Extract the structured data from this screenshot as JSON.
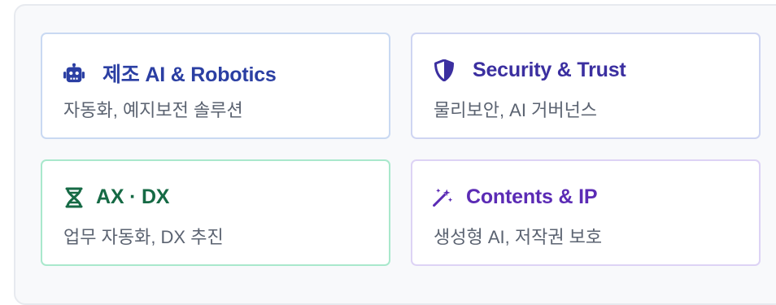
{
  "cards": [
    {
      "title": "제조 AI & Robotics",
      "description": "자동화, 예지보전 솔루션",
      "icon": "robot-icon",
      "color": "#2b3fa3",
      "border": "#c9d9f2"
    },
    {
      "title": "Security & Trust",
      "description": "물리보안, AI 거버넌스",
      "icon": "shield-icon",
      "color": "#3b2fa0",
      "border": "#cfd5f2"
    },
    {
      "title": "AX · DX",
      "description": "업무 자동화, DX 추진",
      "icon": "dna-icon",
      "color": "#166a45",
      "border": "#a9e8cc"
    },
    {
      "title": "Contents & IP",
      "description": "생성형 AI, 저작권 보호",
      "icon": "magic-wand-icon",
      "color": "#5b2bb5",
      "border": "#ddd3f5"
    }
  ]
}
